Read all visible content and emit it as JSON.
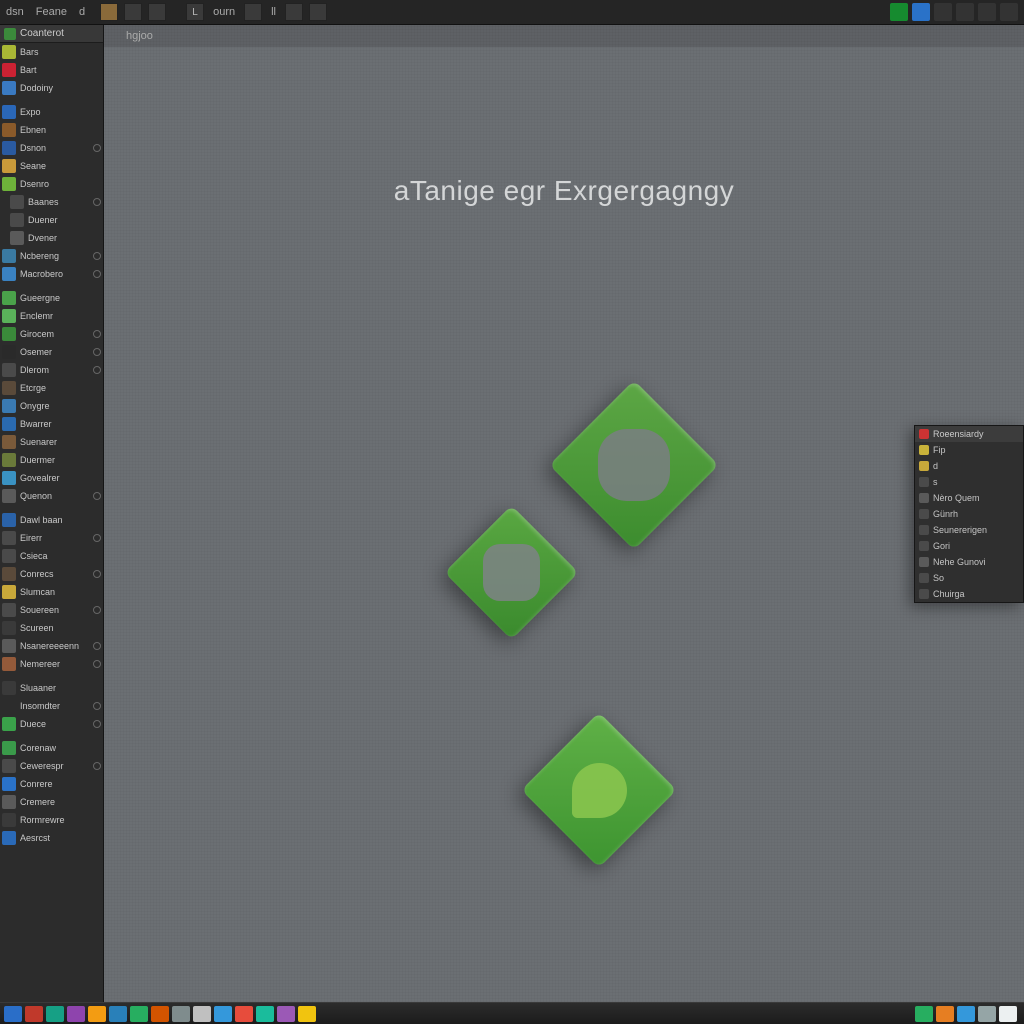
{
  "topbar": {
    "menu": [
      "dsn",
      "Feane",
      "d"
    ],
    "tool_labels": [
      "L",
      "ourn",
      "ll"
    ],
    "tray_count": 6
  },
  "tab_strip": {
    "tab": "hgjoo"
  },
  "canvas": {
    "title": "aTanige egr Exrgergagngy"
  },
  "left_panel": {
    "header": "Coanterot",
    "groups": [
      {
        "items": [
          {
            "label": "Bars",
            "icon": "#a9b735"
          },
          {
            "label": "Bart",
            "icon": "#c23"
          },
          {
            "label": "Dodoiny",
            "icon": "#3a7ac2"
          }
        ]
      },
      {
        "items": [
          {
            "label": "Expo",
            "icon": "#2a67b8"
          },
          {
            "label": "Ebnen",
            "icon": "#8a5a2a"
          },
          {
            "label": "Dsnon",
            "icon": "#2a5aa0",
            "toggle": true
          },
          {
            "label": "Seane",
            "icon": "#c89a3a"
          },
          {
            "label": "Dsenro",
            "icon": "#6eb23a"
          },
          {
            "label": "Baanes",
            "icon": "#4a4a4a",
            "indent": true,
            "toggle": true
          },
          {
            "label": "Duener",
            "icon": "#4a4a4a",
            "indent": true
          },
          {
            "label": "Dvener",
            "icon": "#5a5a5a",
            "indent": true
          },
          {
            "label": "Ncbereng",
            "icon": "#3a7aa2",
            "toggle": true
          },
          {
            "label": "Macrobero",
            "icon": "#3a82c2",
            "toggle": true
          }
        ]
      },
      {
        "items": [
          {
            "label": "Gueergne",
            "icon": "#4aa24a"
          },
          {
            "label": "Enclemr",
            "icon": "#5ab25a"
          },
          {
            "label": "Girocem",
            "icon": "#3a8a3a",
            "toggle": true
          },
          {
            "label": "Osemer",
            "icon": "#2a2a2a",
            "toggle": true
          },
          {
            "label": "Dlerom",
            "icon": "#4a4a4a",
            "toggle": true
          },
          {
            "label": "Etcrge",
            "icon": "#5a4a3a"
          },
          {
            "label": "Onygre",
            "icon": "#3a7ab2"
          },
          {
            "label": "Bwarrer",
            "icon": "#2a6ab0"
          },
          {
            "label": "Suenarer",
            "icon": "#7a5a3a"
          },
          {
            "label": "Duermer",
            "icon": "#6a7a3a"
          },
          {
            "label": "Govealrer",
            "icon": "#3a92c2"
          },
          {
            "label": "Quenon",
            "icon": "#5a5a5a",
            "toggle": true
          }
        ]
      },
      {
        "items": [
          {
            "label": "Dawl baan",
            "icon": "#2a62a8"
          },
          {
            "label": "Eirerr",
            "icon": "#4a4a4a",
            "toggle": true
          },
          {
            "label": "Csieca",
            "icon": "#4a4a4a"
          },
          {
            "label": "Conrecs",
            "icon": "#5a4a3a",
            "toggle": true
          },
          {
            "label": "Slumcan",
            "icon": "#c8a83a"
          },
          {
            "label": "Souereen",
            "icon": "#4a4a4a",
            "toggle": true
          },
          {
            "label": "Scureen",
            "icon": "#3a3a3a"
          },
          {
            "label": "Nsanereeeenn",
            "icon": "#5a5a5a",
            "toggle": true
          },
          {
            "label": "Nemereer",
            "icon": "#945a3a",
            "toggle": true
          }
        ]
      },
      {
        "items": [
          {
            "label": "Sluaaner",
            "icon": "#3a3a3a"
          },
          {
            "label": "Insomdter",
            "icon": "#2c2c2c",
            "toggle": true
          },
          {
            "label": "Duece",
            "icon": "#3aa24a",
            "toggle": true
          }
        ]
      },
      {
        "items": [
          {
            "label": "Corenaw",
            "icon": "#3a9a4a"
          },
          {
            "label": "Cewerespr",
            "icon": "#4a4a4a",
            "toggle": true
          },
          {
            "label": "Conrere",
            "icon": "#2a72c8"
          },
          {
            "label": "Cremere",
            "icon": "#5a5a5a"
          },
          {
            "label": "Rormrewre",
            "icon": "#3a3a3a"
          },
          {
            "label": "Aesrcst",
            "icon": "#2a6ab8"
          }
        ]
      }
    ]
  },
  "float_panel": {
    "header": "Roeensiardy",
    "items": [
      {
        "label": "Fip",
        "icon": "#c8b23a"
      },
      {
        "label": "d",
        "icon": "#c8a83a"
      },
      {
        "label": "s",
        "icon": "#4a4a4a"
      },
      {
        "label": "Nèro Quem",
        "icon": "#5a5a5a"
      },
      {
        "label": "Günrh",
        "icon": "#4a4a4a"
      },
      {
        "label": "Seunererigen",
        "icon": "#4a4a4a"
      },
      {
        "label": "Gori",
        "icon": "#4a4a4a"
      },
      {
        "label": "Nehe Gunovi",
        "icon": "#5a5a5a"
      },
      {
        "label": "So",
        "icon": "#4a4a4a"
      },
      {
        "label": "Chuirga",
        "icon": "#4a4a4a"
      }
    ]
  },
  "taskbar": {
    "items": [
      "#2a6ec8",
      "#c0392b",
      "#16a085",
      "#8e44ad",
      "#f39c12",
      "#2980b9",
      "#27ae60",
      "#d35400",
      "#7f8c8d",
      "#c0c0c0",
      "#3498db",
      "#e74c3c",
      "#1abc9c",
      "#9b59b6",
      "#f1c40f"
    ],
    "right_items": [
      "#27ae60",
      "#e67e22",
      "#3498db",
      "#95a5a6",
      "#ecf0f1"
    ]
  },
  "colors": {
    "accent": "#4aa23a"
  }
}
